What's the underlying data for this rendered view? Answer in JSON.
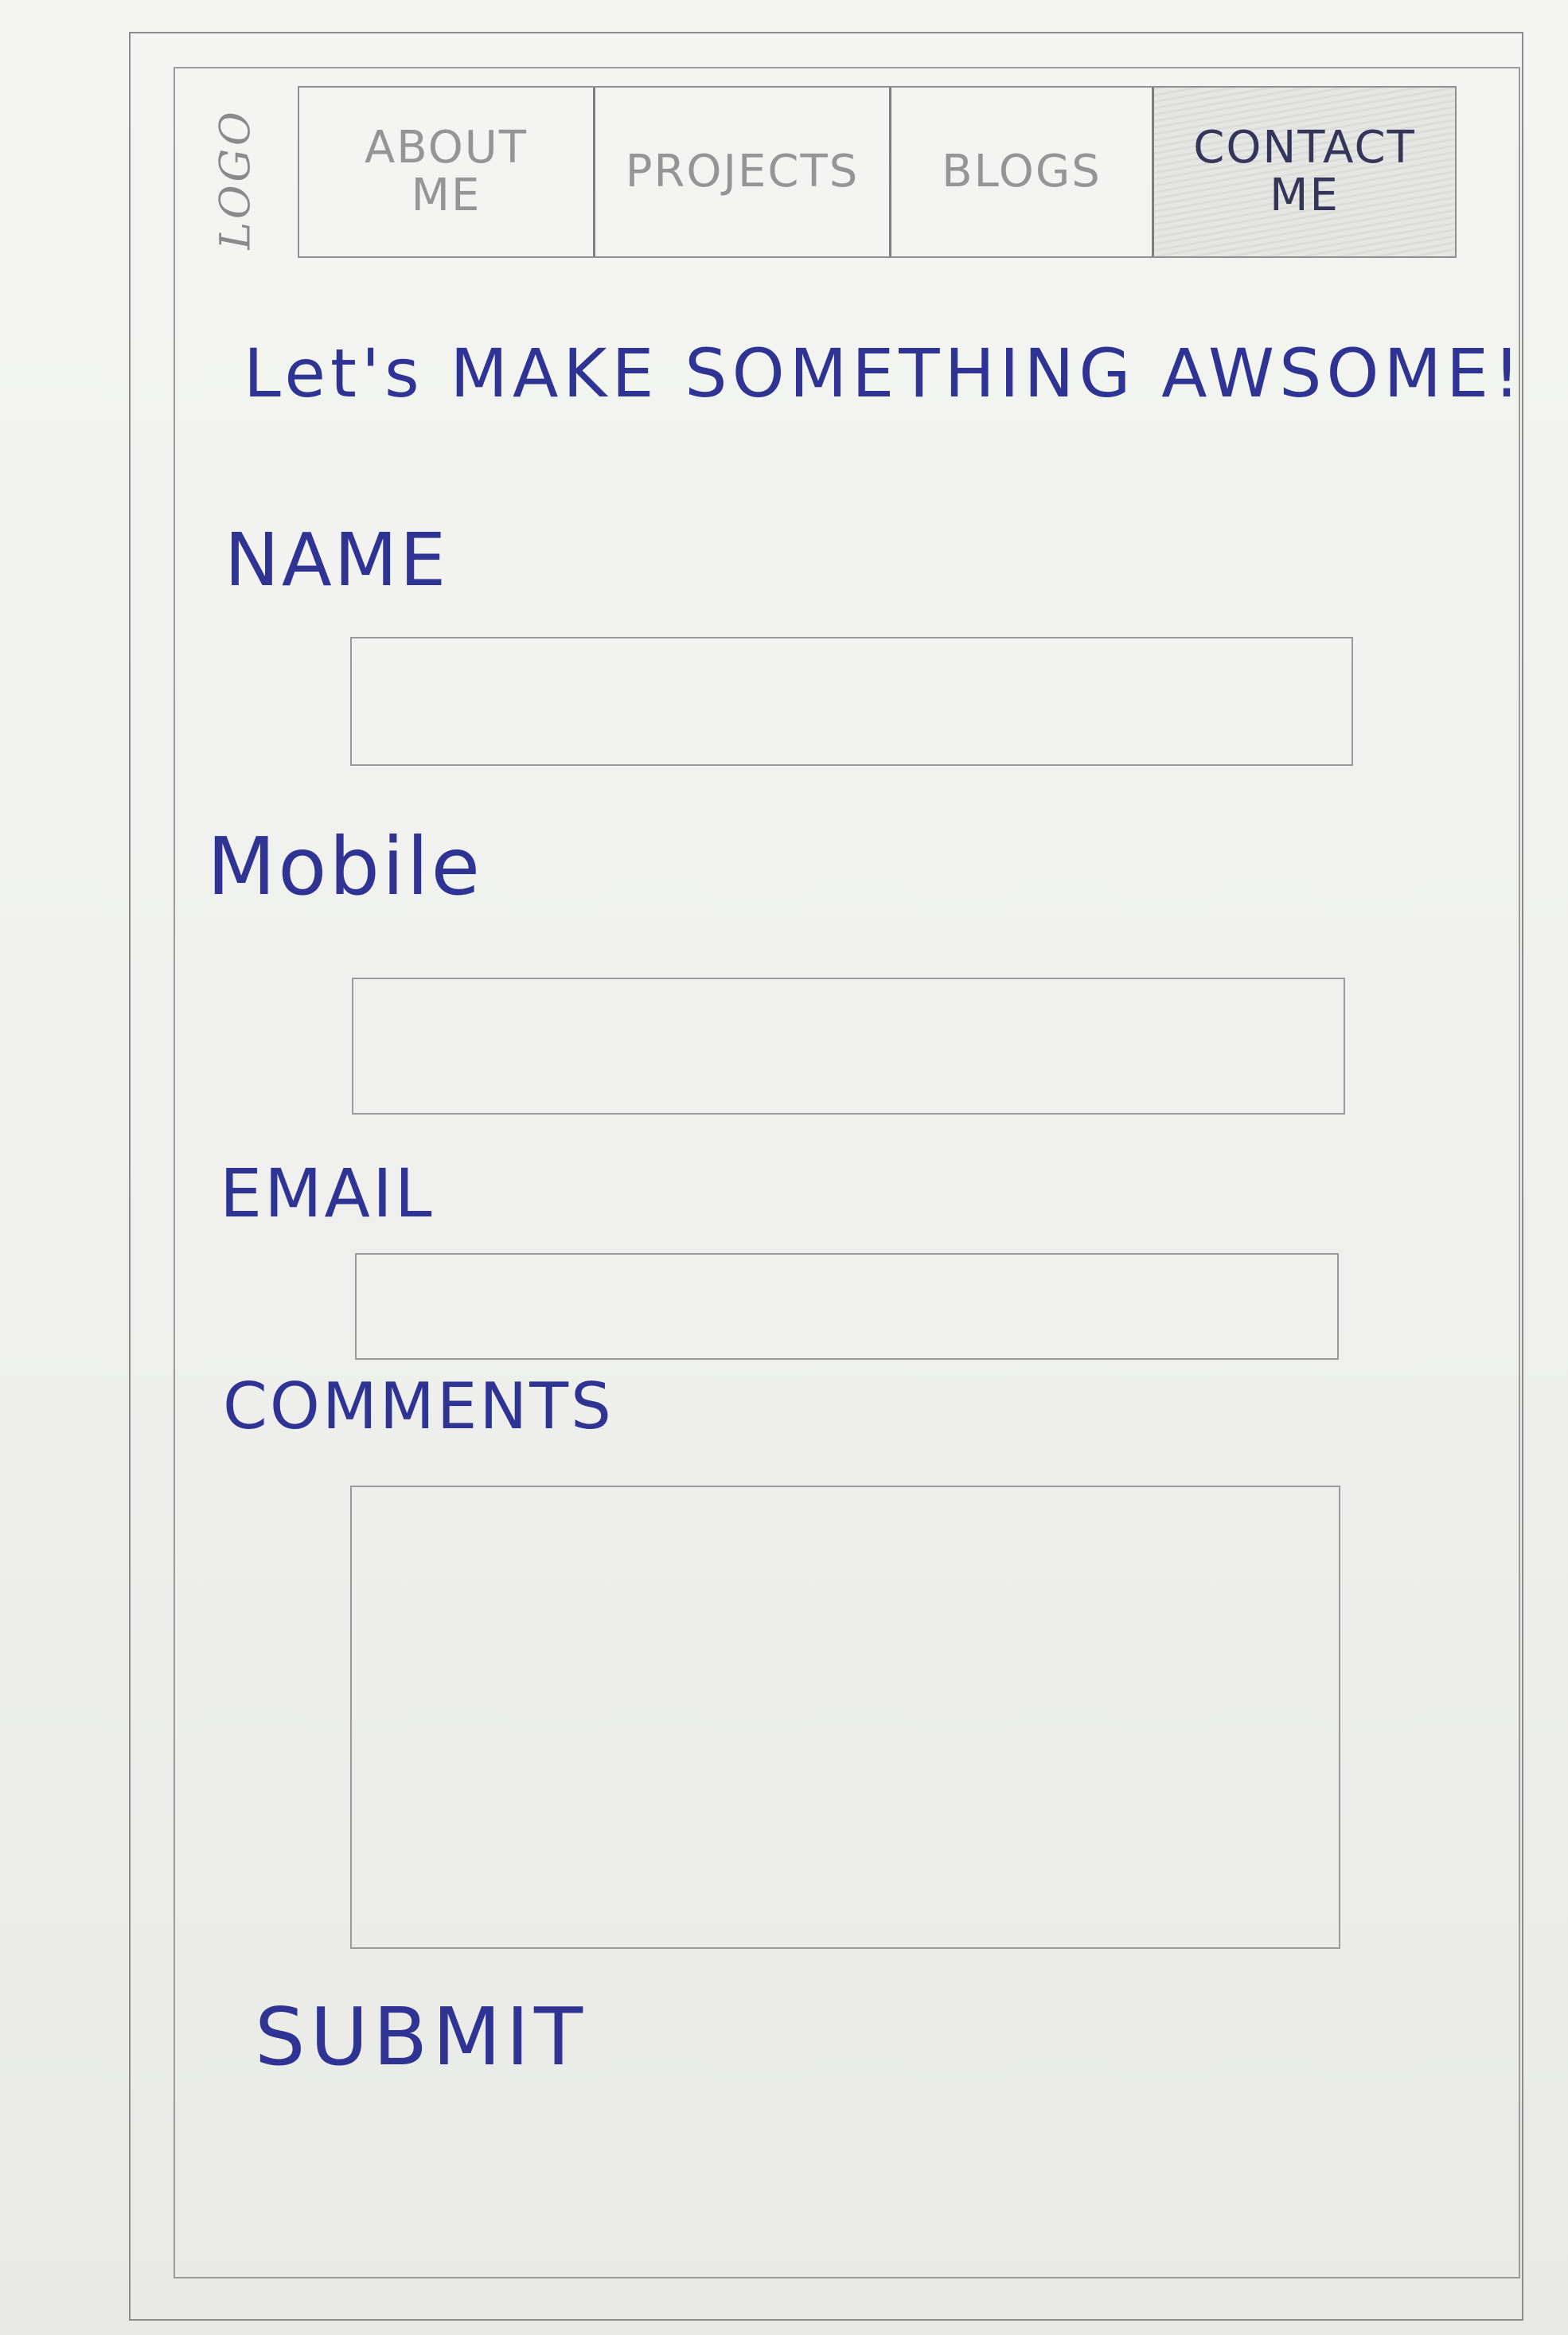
{
  "logo": {
    "text": "LOGO"
  },
  "nav": {
    "items": [
      {
        "label": "ABOUT\nME",
        "active": false
      },
      {
        "label": "PROJECTS",
        "active": false
      },
      {
        "label": "BLOGS",
        "active": false
      },
      {
        "label": "CONTACT\nME",
        "active": true
      }
    ]
  },
  "main": {
    "headline": "Let's MAKE SOMETHING AWSOME!",
    "fields": {
      "name_label": "NAME",
      "mobile_label": "Mobile",
      "email_label": "EMAIL",
      "comments_label": "COMMENTS"
    },
    "submit_label": "SUBMIT"
  },
  "colors": {
    "ink": "#2e3394",
    "pencil": "#8c8c8c",
    "paper": "#f1f2ef"
  }
}
